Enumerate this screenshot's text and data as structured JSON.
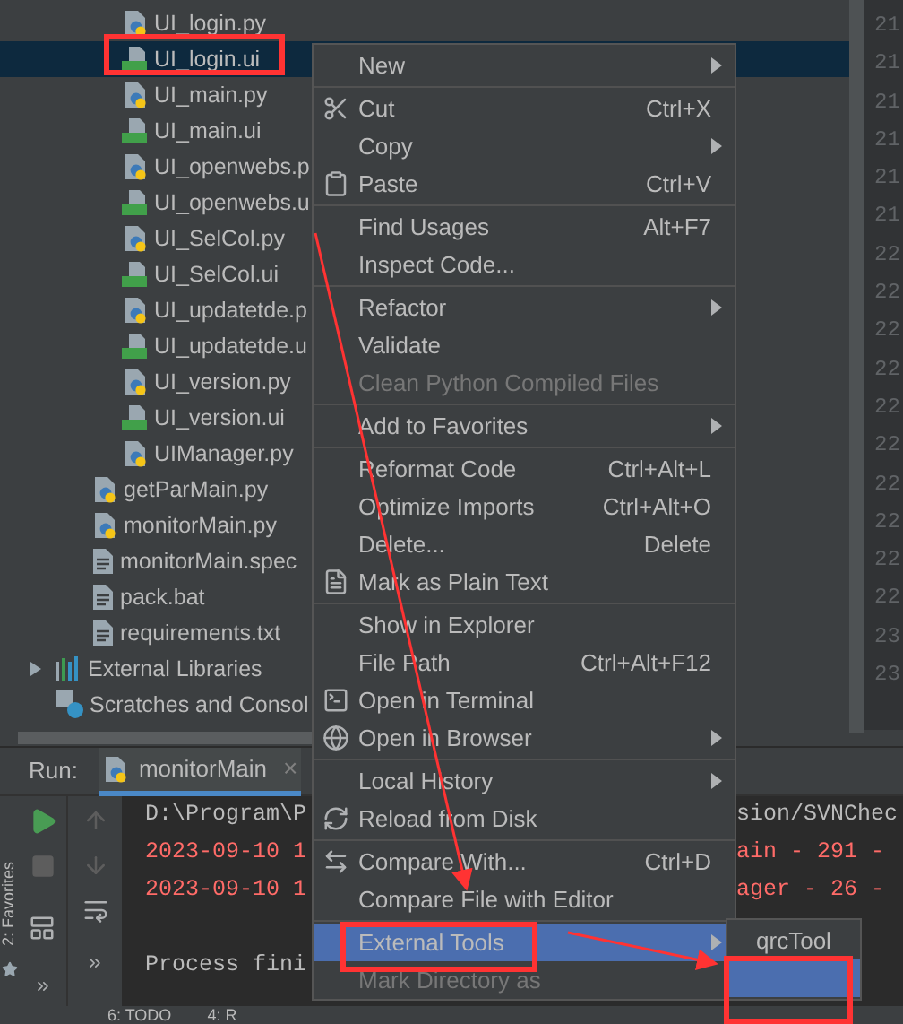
{
  "project_tree": {
    "nested_files": [
      {
        "name": "UI_login.py",
        "kind": "python",
        "selected": false
      },
      {
        "name": "UI_login.ui",
        "kind": "qt",
        "selected": true
      },
      {
        "name": "UI_main.py",
        "kind": "python",
        "selected": false
      },
      {
        "name": "UI_main.ui",
        "kind": "qt",
        "selected": false
      },
      {
        "name": "UI_openwebs.p",
        "kind": "python",
        "selected": false
      },
      {
        "name": "UI_openwebs.u",
        "kind": "qt",
        "selected": false
      },
      {
        "name": "UI_SelCol.py",
        "kind": "python",
        "selected": false
      },
      {
        "name": "UI_SelCol.ui",
        "kind": "qt",
        "selected": false
      },
      {
        "name": "UI_updatetde.p",
        "kind": "python",
        "selected": false
      },
      {
        "name": "UI_updatetde.u",
        "kind": "qt",
        "selected": false
      },
      {
        "name": "UI_version.py",
        "kind": "python",
        "selected": false
      },
      {
        "name": "UI_version.ui",
        "kind": "qt",
        "selected": false
      },
      {
        "name": "UIManager.py",
        "kind": "python",
        "selected": false
      }
    ],
    "files": [
      {
        "name": "getParMain.py",
        "kind": "python",
        "selected": false
      },
      {
        "name": "monitorMain.py",
        "kind": "python",
        "selected": false
      },
      {
        "name": "monitorMain.spec",
        "kind": "text",
        "selected": false
      },
      {
        "name": "pack.bat",
        "kind": "text",
        "selected": false
      },
      {
        "name": "requirements.txt",
        "kind": "text",
        "selected": false
      }
    ],
    "roots": [
      {
        "name": "External Libraries",
        "kind": "library",
        "expanded": false
      },
      {
        "name": "Scratches and Consol",
        "kind": "scratches"
      }
    ]
  },
  "line_numbers": [
    "21",
    "21",
    "21",
    "21",
    "21",
    "21",
    "22",
    "22",
    "22",
    "22",
    "22",
    "22",
    "22",
    "22",
    "22",
    "22",
    "23",
    "23"
  ],
  "favorites_tab": {
    "label": "2: Favorites"
  },
  "run_panel": {
    "label": "Run:",
    "tab": {
      "label": "monitorMain",
      "close": "×",
      "selected": true
    },
    "console": [
      {
        "left": "D:\\Program\\P",
        "right": "sion/SVNChec",
        "error": false,
        "blank_before": false
      },
      {
        "left": "2023-09-10 1",
        "right": "ain - 291  -",
        "error": true,
        "blank_before": false
      },
      {
        "left": "2023-09-10 1",
        "right": "ager - 26  -",
        "error": true,
        "blank_before": false
      },
      {
        "left": "Process fini",
        "error": false,
        "blank_before": true
      }
    ]
  },
  "context_menu": {
    "groups": [
      {
        "items": [
          {
            "label": "New",
            "has_submenu": true,
            "disabled": false,
            "selected": false
          }
        ]
      },
      {
        "items": [
          {
            "label": "Cut",
            "shortcut": "Ctrl+X",
            "has_submenu": false,
            "disabled": false,
            "selected": false
          },
          {
            "label": "Copy",
            "has_submenu": true,
            "disabled": false,
            "selected": false
          },
          {
            "label": "Paste",
            "shortcut": "Ctrl+V",
            "has_submenu": false,
            "disabled": false,
            "selected": false
          }
        ]
      },
      {
        "items": [
          {
            "label": "Find Usages",
            "shortcut": "Alt+F7",
            "has_submenu": false,
            "disabled": false,
            "selected": false
          },
          {
            "label": "Inspect Code...",
            "has_submenu": false,
            "disabled": false,
            "selected": false
          }
        ]
      },
      {
        "items": [
          {
            "label": "Refactor",
            "has_submenu": true,
            "disabled": false,
            "selected": false
          },
          {
            "label": "Validate",
            "has_submenu": false,
            "disabled": false,
            "selected": false
          },
          {
            "label": "Clean Python Compiled Files",
            "has_submenu": false,
            "disabled": true,
            "selected": false
          }
        ]
      },
      {
        "items": [
          {
            "label": "Add to Favorites",
            "has_submenu": true,
            "disabled": false,
            "selected": false
          }
        ]
      },
      {
        "items": [
          {
            "label": "Reformat Code",
            "shortcut": "Ctrl+Alt+L",
            "has_submenu": false,
            "disabled": false,
            "selected": false
          },
          {
            "label": "Optimize Imports",
            "shortcut": "Ctrl+Alt+O",
            "has_submenu": false,
            "disabled": false,
            "selected": false
          },
          {
            "label": "Delete...",
            "shortcut": "Delete",
            "has_submenu": false,
            "disabled": false,
            "selected": false
          },
          {
            "label": "Mark as Plain Text",
            "has_submenu": false,
            "disabled": false,
            "selected": false
          }
        ]
      },
      {
        "items": [
          {
            "label": "Show in Explorer",
            "has_submenu": false,
            "disabled": false,
            "selected": false
          },
          {
            "label": "File Path",
            "shortcut": "Ctrl+Alt+F12",
            "has_submenu": false,
            "disabled": false,
            "selected": false
          },
          {
            "label": "Open in Terminal",
            "has_submenu": false,
            "disabled": false,
            "selected": false
          },
          {
            "label": "Open in Browser",
            "has_submenu": true,
            "disabled": false,
            "selected": false
          }
        ]
      },
      {
        "items": [
          {
            "label": "Local History",
            "has_submenu": true,
            "disabled": false,
            "selected": false
          },
          {
            "label": "Reload from Disk",
            "has_submenu": false,
            "disabled": false,
            "selected": false
          }
        ]
      },
      {
        "items": [
          {
            "label": "Compare With...",
            "shortcut": "Ctrl+D",
            "has_submenu": false,
            "disabled": false,
            "selected": false
          },
          {
            "label": "Compare File with Editor",
            "has_submenu": false,
            "disabled": false,
            "selected": false
          }
        ]
      },
      {
        "items": [
          {
            "label": "External Tools",
            "has_submenu": true,
            "disabled": false,
            "selected": true
          },
          {
            "label": "Mark Directory as",
            "has_submenu": false,
            "disabled": true,
            "selected": false
          }
        ]
      }
    ]
  },
  "submenu": {
    "items": [
      {
        "label": "qrcTool",
        "selected": false
      },
      {
        "selected": true
      }
    ]
  },
  "status_bar": {
    "tabs": [
      "6: TODO",
      "4: R"
    ]
  }
}
